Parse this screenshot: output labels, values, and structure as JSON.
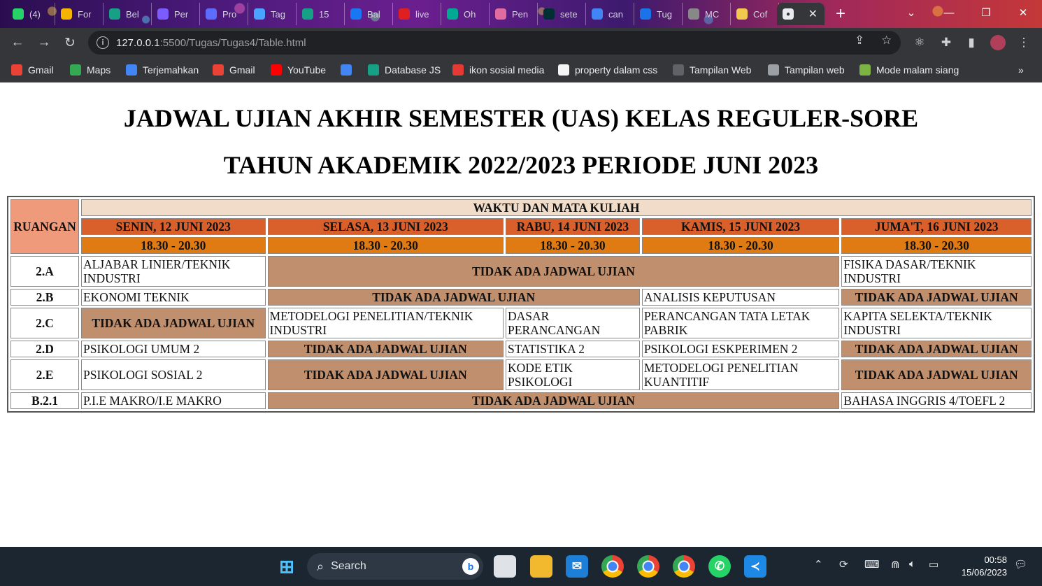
{
  "browser": {
    "tabs": [
      {
        "label": "(4)",
        "icon": "whatsapp-icon",
        "color": "#25d366"
      },
      {
        "label": "For",
        "icon": "form-icon",
        "color": "#f4b400"
      },
      {
        "label": "Bel",
        "icon": "codepolitan-icon",
        "color": "#16a085"
      },
      {
        "label": "Per",
        "icon": "hash-icon",
        "color": "#7b5cff"
      },
      {
        "label": "Pro",
        "icon": "meta-icon",
        "color": "#5b6cff"
      },
      {
        "label": "Tag",
        "icon": "tag-icon",
        "color": "#4aa3ff"
      },
      {
        "label": "15",
        "icon": "codepolitan-icon",
        "color": "#16a085"
      },
      {
        "label": "Bal",
        "icon": "messenger-icon",
        "color": "#1877f2"
      },
      {
        "label": "live",
        "icon": "y-icon",
        "color": "#e02020"
      },
      {
        "label": "Oh",
        "icon": "dt-icon",
        "color": "#00a991"
      },
      {
        "label": "Pen",
        "icon": "gear-icon",
        "color": "#e06c9f"
      },
      {
        "label": "sete",
        "icon": "olx-icon",
        "color": "#002f34"
      },
      {
        "label": "can",
        "icon": "google-icon",
        "color": "#4285f4"
      },
      {
        "label": "Tug",
        "icon": "classroom-icon",
        "color": "#1a73e8"
      },
      {
        "label": "MC",
        "icon": "globe-icon",
        "color": "#888888"
      },
      {
        "label": "Cof",
        "icon": "cup-icon",
        "color": "#f2c94c"
      }
    ],
    "active_tab_icon": "globe-icon",
    "new_tab": "+",
    "url_host": "127.0.0.1",
    "url_path": ":5500/Tugas/Tugas4/Table.html",
    "bookmarks": [
      {
        "label": "Gmail",
        "icon": "gmail-icon",
        "color": "#ea4335"
      },
      {
        "label": "Maps",
        "icon": "maps-icon",
        "color": "#34a853"
      },
      {
        "label": "Terjemahkan",
        "icon": "translate-icon",
        "color": "#4285f4"
      },
      {
        "label": "Gmail",
        "icon": "gmail-icon",
        "color": "#ea4335"
      },
      {
        "label": "YouTube",
        "icon": "youtube-icon",
        "color": "#ff0000"
      },
      {
        "label": "",
        "icon": "google-icon",
        "color": "#4285f4"
      },
      {
        "label": "Database JS",
        "icon": "codepolitan-icon",
        "color": "#16a085"
      },
      {
        "label": "ikon sosial media",
        "icon": "bookmark-red-icon",
        "color": "#e53935"
      },
      {
        "label": "property dalam css",
        "icon": "pipe-icon",
        "color": "#f5f5f5"
      },
      {
        "label": "Tampilan Web",
        "icon": "v-icon",
        "color": "#5f6368"
      },
      {
        "label": "Tampilan web",
        "icon": "globe-icon",
        "color": "#9aa0a6"
      },
      {
        "label": "Mode malam siang",
        "icon": "leaf-icon",
        "color": "#7cb342"
      }
    ]
  },
  "page": {
    "title_line1": "JADWAL UJIAN AKHIR SEMESTER (UAS) KELAS REGULER-SORE",
    "title_line2": "TAHUN AKADEMIK 2022/2023 PERIODE JUNI 2023",
    "table": {
      "room_header": "RUANGAN",
      "group_header": "WAKTU DAN MATA KULIAH",
      "days": [
        "SENIN, 12 JUNI 2023",
        "SELASA, 13 JUNI 2023",
        "RABU, 14 JUNI 2023",
        "KAMIS, 15 JUNI 2023",
        "JUMA'T, 16 JUNI 2023"
      ],
      "times": [
        "18.30 - 20.30",
        "18.30 - 20.30",
        "18.30 - 20.30",
        "18.30 - 20.30",
        "18.30 - 20.30"
      ],
      "no_exam": "TIDAK ADA JADWAL UJIAN",
      "rows": [
        {
          "room": "2.A",
          "senin": "ALJABAR LINIER/TEKNIK INDUSTRI",
          "jumat": "FISIKA DASAR/TEKNIK INDUSTRI"
        },
        {
          "room": "2.B",
          "senin": "EKONOMI TEKNIK",
          "kamis": "ANALISIS KEPUTUSAN"
        },
        {
          "room": "2.C",
          "selasa": "METODELOGI PENELITIAN/TEKNIK INDUSTRI",
          "rabu": "DASAR PERANCANGAN",
          "kamis": "PERANCANGAN TATA LETAK PABRIK",
          "jumat": "KAPITA SELEKTA/TEKNIK INDUSTRI"
        },
        {
          "room": "2.D",
          "senin": "PSIKOLOGI UMUM 2",
          "rabu": "STATISTIKA 2",
          "kamis": "PSIKOLOGI ESKPERIMEN 2"
        },
        {
          "room": "2.E",
          "senin": "PSIKOLOGI SOSIAL 2",
          "rabu": "KODE ETIK PSIKOLOGI",
          "kamis": "METODELOGI PENELITIAN KUANTITIF"
        },
        {
          "room": "B.2.1",
          "senin": "P.I.E MAKRO/I.E MAKRO",
          "jumat": "BAHASA INGGRIS 4/TOEFL 2"
        }
      ]
    }
  },
  "taskbar": {
    "search_label": "Search",
    "time": "00:58",
    "date": "15/06/2023"
  }
}
